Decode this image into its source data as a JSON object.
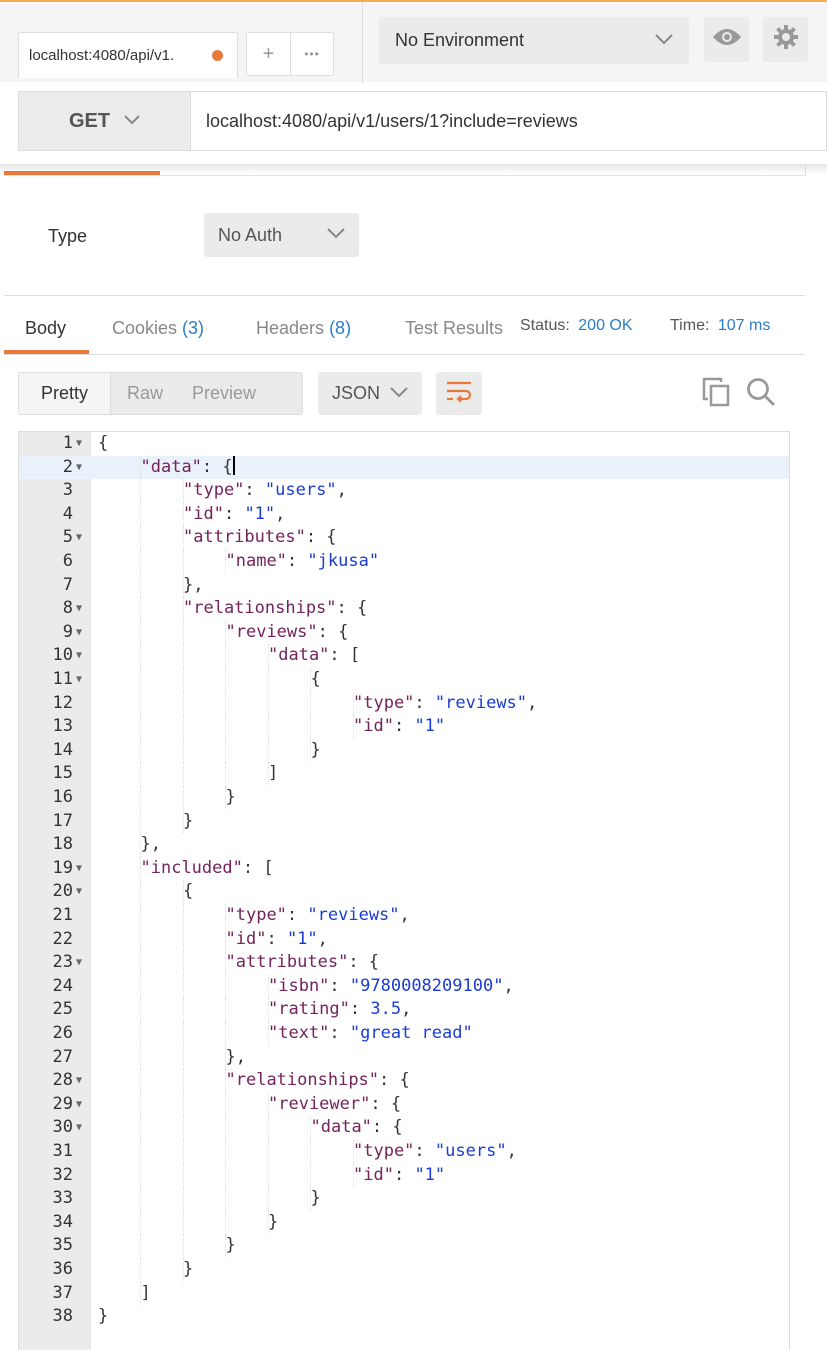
{
  "top": {
    "tab_title": "localhost:4080/api/v1.",
    "new_tab": "+",
    "more_tabs": "•••",
    "environment": "No Environment"
  },
  "request": {
    "method": "GET",
    "url": "localhost:4080/api/v1/users/1?include=reviews"
  },
  "auth": {
    "type_label": "Type",
    "type_value": "No Auth"
  },
  "response_tabs": {
    "body": "Body",
    "cookies": "Cookies",
    "cookies_count": "(3)",
    "headers": "Headers",
    "headers_count": "(8)",
    "test_results": "Test Results"
  },
  "status": {
    "status_label": "Status:",
    "status_value": "200 OK",
    "time_label": "Time:",
    "time_value": "107 ms"
  },
  "view": {
    "pretty": "Pretty",
    "raw": "Raw",
    "preview": "Preview",
    "format": "JSON"
  },
  "icons": {
    "eye": "eye-icon",
    "gear": "gear-icon",
    "wrap": "wrap-lines-icon",
    "copy": "copy-icon",
    "search": "search-icon"
  },
  "colors": {
    "accent": "#e8793b",
    "link": "#2a7ec9",
    "json_key": "#75235b",
    "json_string": "#1a3bd4"
  },
  "code_lines": [
    {
      "n": "1",
      "fold": true,
      "indent": 0,
      "parts": [
        [
          "p",
          "{"
        ]
      ]
    },
    {
      "n": "2",
      "fold": true,
      "indent": 1,
      "parts": [
        [
          "k",
          "\"data\""
        ],
        [
          "p",
          ": {"
        ]
      ],
      "highlight": true
    },
    {
      "n": "3",
      "fold": false,
      "indent": 2,
      "parts": [
        [
          "k",
          "\"type\""
        ],
        [
          "p",
          ": "
        ],
        [
          "s",
          "\"users\""
        ],
        [
          "p",
          ","
        ]
      ]
    },
    {
      "n": "4",
      "fold": false,
      "indent": 2,
      "parts": [
        [
          "k",
          "\"id\""
        ],
        [
          "p",
          ": "
        ],
        [
          "s",
          "\"1\""
        ],
        [
          "p",
          ","
        ]
      ]
    },
    {
      "n": "5",
      "fold": true,
      "indent": 2,
      "parts": [
        [
          "k",
          "\"attributes\""
        ],
        [
          "p",
          ": {"
        ]
      ]
    },
    {
      "n": "6",
      "fold": false,
      "indent": 3,
      "parts": [
        [
          "k",
          "\"name\""
        ],
        [
          "p",
          ": "
        ],
        [
          "s",
          "\"jkusa\""
        ]
      ]
    },
    {
      "n": "7",
      "fold": false,
      "indent": 2,
      "parts": [
        [
          "p",
          "},"
        ]
      ]
    },
    {
      "n": "8",
      "fold": true,
      "indent": 2,
      "parts": [
        [
          "k",
          "\"relationships\""
        ],
        [
          "p",
          ": {"
        ]
      ]
    },
    {
      "n": "9",
      "fold": true,
      "indent": 3,
      "parts": [
        [
          "k",
          "\"reviews\""
        ],
        [
          "p",
          ": {"
        ]
      ]
    },
    {
      "n": "10",
      "fold": true,
      "indent": 4,
      "parts": [
        [
          "k",
          "\"data\""
        ],
        [
          "p",
          ": ["
        ]
      ]
    },
    {
      "n": "11",
      "fold": true,
      "indent": 5,
      "parts": [
        [
          "p",
          "{"
        ]
      ]
    },
    {
      "n": "12",
      "fold": false,
      "indent": 6,
      "parts": [
        [
          "k",
          "\"type\""
        ],
        [
          "p",
          ": "
        ],
        [
          "s",
          "\"reviews\""
        ],
        [
          "p",
          ","
        ]
      ]
    },
    {
      "n": "13",
      "fold": false,
      "indent": 6,
      "parts": [
        [
          "k",
          "\"id\""
        ],
        [
          "p",
          ": "
        ],
        [
          "s",
          "\"1\""
        ]
      ]
    },
    {
      "n": "14",
      "fold": false,
      "indent": 5,
      "parts": [
        [
          "p",
          "}"
        ]
      ]
    },
    {
      "n": "15",
      "fold": false,
      "indent": 4,
      "parts": [
        [
          "p",
          "]"
        ]
      ]
    },
    {
      "n": "16",
      "fold": false,
      "indent": 3,
      "parts": [
        [
          "p",
          "}"
        ]
      ]
    },
    {
      "n": "17",
      "fold": false,
      "indent": 2,
      "parts": [
        [
          "p",
          "}"
        ]
      ]
    },
    {
      "n": "18",
      "fold": false,
      "indent": 1,
      "parts": [
        [
          "p",
          "},"
        ]
      ]
    },
    {
      "n": "19",
      "fold": true,
      "indent": 1,
      "parts": [
        [
          "k",
          "\"included\""
        ],
        [
          "p",
          ": ["
        ]
      ]
    },
    {
      "n": "20",
      "fold": true,
      "indent": 2,
      "parts": [
        [
          "p",
          "{"
        ]
      ]
    },
    {
      "n": "21",
      "fold": false,
      "indent": 3,
      "parts": [
        [
          "k",
          "\"type\""
        ],
        [
          "p",
          ": "
        ],
        [
          "s",
          "\"reviews\""
        ],
        [
          "p",
          ","
        ]
      ]
    },
    {
      "n": "22",
      "fold": false,
      "indent": 3,
      "parts": [
        [
          "k",
          "\"id\""
        ],
        [
          "p",
          ": "
        ],
        [
          "s",
          "\"1\""
        ],
        [
          "p",
          ","
        ]
      ]
    },
    {
      "n": "23",
      "fold": true,
      "indent": 3,
      "parts": [
        [
          "k",
          "\"attributes\""
        ],
        [
          "p",
          ": {"
        ]
      ]
    },
    {
      "n": "24",
      "fold": false,
      "indent": 4,
      "parts": [
        [
          "k",
          "\"isbn\""
        ],
        [
          "p",
          ": "
        ],
        [
          "s",
          "\"9780008209100\""
        ],
        [
          "p",
          ","
        ]
      ]
    },
    {
      "n": "25",
      "fold": false,
      "indent": 4,
      "parts": [
        [
          "k",
          "\"rating\""
        ],
        [
          "p",
          ": "
        ],
        [
          "n",
          "3.5"
        ],
        [
          "p",
          ","
        ]
      ]
    },
    {
      "n": "26",
      "fold": false,
      "indent": 4,
      "parts": [
        [
          "k",
          "\"text\""
        ],
        [
          "p",
          ": "
        ],
        [
          "s",
          "\"great read\""
        ]
      ]
    },
    {
      "n": "27",
      "fold": false,
      "indent": 3,
      "parts": [
        [
          "p",
          "},"
        ]
      ]
    },
    {
      "n": "28",
      "fold": true,
      "indent": 3,
      "parts": [
        [
          "k",
          "\"relationships\""
        ],
        [
          "p",
          ": {"
        ]
      ]
    },
    {
      "n": "29",
      "fold": true,
      "indent": 4,
      "parts": [
        [
          "k",
          "\"reviewer\""
        ],
        [
          "p",
          ": {"
        ]
      ]
    },
    {
      "n": "30",
      "fold": true,
      "indent": 5,
      "parts": [
        [
          "k",
          "\"data\""
        ],
        [
          "p",
          ": {"
        ]
      ]
    },
    {
      "n": "31",
      "fold": false,
      "indent": 6,
      "parts": [
        [
          "k",
          "\"type\""
        ],
        [
          "p",
          ": "
        ],
        [
          "s",
          "\"users\""
        ],
        [
          "p",
          ","
        ]
      ]
    },
    {
      "n": "32",
      "fold": false,
      "indent": 6,
      "parts": [
        [
          "k",
          "\"id\""
        ],
        [
          "p",
          ": "
        ],
        [
          "s",
          "\"1\""
        ]
      ]
    },
    {
      "n": "33",
      "fold": false,
      "indent": 5,
      "parts": [
        [
          "p",
          "}"
        ]
      ]
    },
    {
      "n": "34",
      "fold": false,
      "indent": 4,
      "parts": [
        [
          "p",
          "}"
        ]
      ]
    },
    {
      "n": "35",
      "fold": false,
      "indent": 3,
      "parts": [
        [
          "p",
          "}"
        ]
      ]
    },
    {
      "n": "36",
      "fold": false,
      "indent": 2,
      "parts": [
        [
          "p",
          "}"
        ]
      ]
    },
    {
      "n": "37",
      "fold": false,
      "indent": 1,
      "parts": [
        [
          "p",
          "]"
        ]
      ]
    },
    {
      "n": "38",
      "fold": false,
      "indent": 0,
      "parts": [
        [
          "p",
          "}"
        ]
      ]
    }
  ]
}
